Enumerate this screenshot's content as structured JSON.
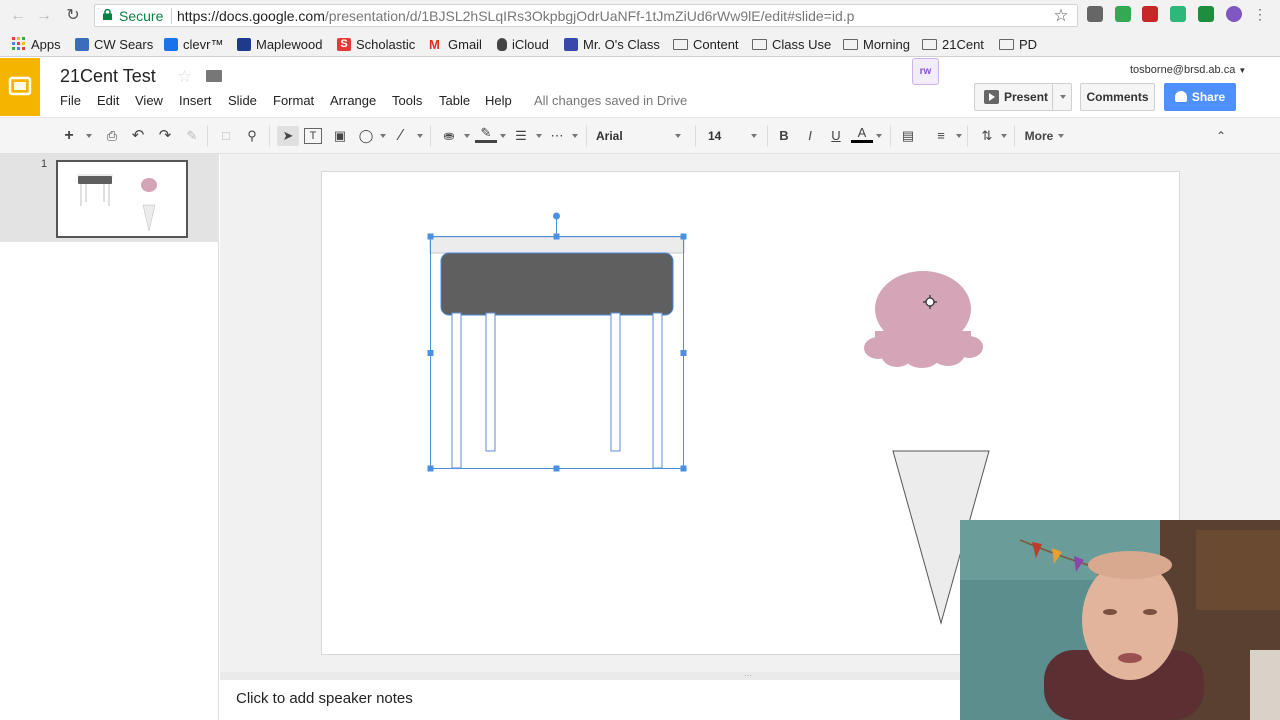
{
  "browser": {
    "nav": {
      "back_icon": "back-arrow-icon",
      "forward_icon": "forward-arrow-icon",
      "reload_icon": "reload-icon"
    },
    "security_label": "Secure",
    "url_host": "https://docs.google.com",
    "url_path": "/presentation/d/1BJSL2hSLqIRs3OkpbgjOdrUaNFf-1tJmZiUd6rWw9lE/edit#slide=id.p",
    "bookmarks": [
      {
        "label": "Apps",
        "icon": "apps-grid-icon",
        "color": "#e94235"
      },
      {
        "label": "CW Sears",
        "icon": "cw-sears-icon",
        "color": "#3b6dbb"
      },
      {
        "label": "clevr™",
        "icon": "clever-icon",
        "color": "#1a73e8"
      },
      {
        "label": "Maplewood",
        "icon": "maplewood-icon",
        "color": "#1e3a8a"
      },
      {
        "label": "Scholastic",
        "icon": "scholastic-icon",
        "color": "#e53935"
      },
      {
        "label": "Gmail",
        "icon": "gmail-icon",
        "color": "#d93025"
      },
      {
        "label": "iCloud",
        "icon": "apple-icon",
        "color": "#444444"
      },
      {
        "label": "Mr. O's Class",
        "icon": "calendar-icon",
        "color": "#3949ab"
      },
      {
        "label": "Content",
        "icon": "folder-icon",
        "color": ""
      },
      {
        "label": "Class Use",
        "icon": "folder-icon",
        "color": ""
      },
      {
        "label": "Morning",
        "icon": "folder-icon",
        "color": ""
      },
      {
        "label": "21Cent",
        "icon": "folder-icon",
        "color": ""
      },
      {
        "label": "PD",
        "icon": "folder-icon",
        "color": ""
      }
    ]
  },
  "app": {
    "title": "21Cent Test",
    "menu": [
      "File",
      "Edit",
      "View",
      "Insert",
      "Slide",
      "Format",
      "Arrange",
      "Tools",
      "Table",
      "Help"
    ],
    "save_status": "All changes saved in Drive",
    "account": "tosborne@brsd.ab.ca",
    "present_label": "Present",
    "comments_label": "Comments",
    "share_label": "Share",
    "addon_label": "rw",
    "accent_color": "#f4b400",
    "share_color": "#4d90fe"
  },
  "toolbar": {
    "font_family": "Arial",
    "font_size": "14",
    "bold_label": "B",
    "italic_label": "I",
    "underline_label": "U",
    "text_color_label": "A",
    "more_label": "More"
  },
  "filmstrip": {
    "slides": [
      {
        "number": "1"
      }
    ]
  },
  "canvas": {
    "shapes": [
      {
        "name": "desk",
        "selected": true,
        "color": "#5f5f5f"
      },
      {
        "name": "ice-cream-scoop",
        "color": "#d4a5b6"
      },
      {
        "name": "ice-cream-cone",
        "color": "#ececec"
      }
    ]
  },
  "notes": {
    "placeholder": "Click to add speaker notes"
  }
}
